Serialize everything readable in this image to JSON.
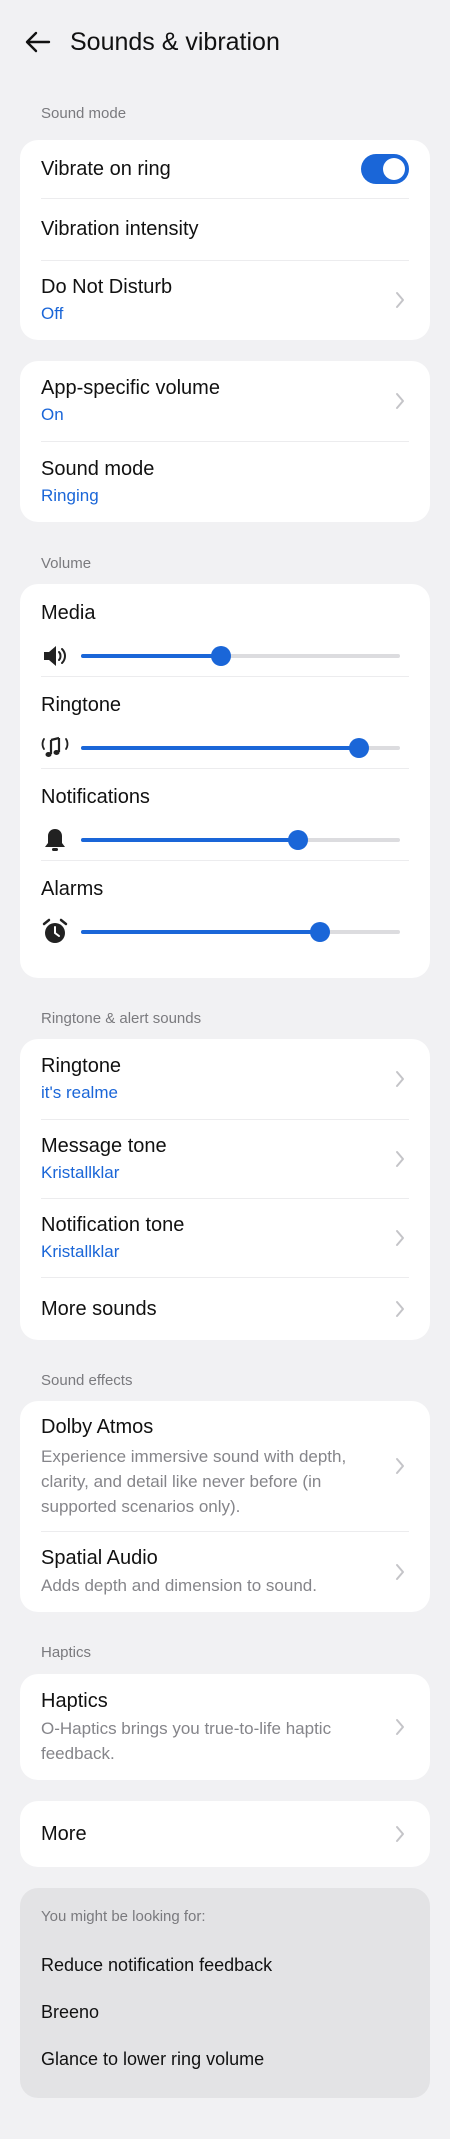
{
  "header": {
    "title": "Sounds & vibration"
  },
  "sections": {
    "sound_mode": "Sound mode",
    "volume": "Volume",
    "ringtone_alert": "Ringtone & alert sounds",
    "sound_effects": "Sound effects",
    "haptics": "Haptics"
  },
  "sound_mode_card": {
    "vibrate_on_ring": "Vibrate on ring",
    "vibrate_on_ring_enabled": true,
    "vibration_intensity": "Vibration intensity",
    "dnd_title": "Do Not Disturb",
    "dnd_value": "Off"
  },
  "app_card": {
    "app_volume_title": "App-specific volume",
    "app_volume_value": "On",
    "sound_mode_title": "Sound mode",
    "sound_mode_value": "Ringing"
  },
  "volume": {
    "media": {
      "label": "Media",
      "level": 0.44
    },
    "ringtone": {
      "label": "Ringtone",
      "level": 0.87
    },
    "notifications": {
      "label": "Notifications",
      "level": 0.68
    },
    "alarms": {
      "label": "Alarms",
      "level": 0.75
    }
  },
  "ringtone_card": {
    "ringtone_title": "Ringtone",
    "ringtone_value": "it's realme",
    "message_title": "Message tone",
    "message_value": "Kristallklar",
    "notification_title": "Notification tone",
    "notification_value": "Kristallklar",
    "more_sounds": "More sounds"
  },
  "effects_card": {
    "dolby_title": "Dolby Atmos",
    "dolby_desc": "Experience immersive sound with depth, clarity, and detail like never before (in supported scenarios only).",
    "spatial_title": "Spatial Audio",
    "spatial_desc": "Adds depth and dimension to sound."
  },
  "haptics_card": {
    "title": "Haptics",
    "desc": "O-Haptics brings you true-to-life haptic feedback."
  },
  "more": {
    "label": "More"
  },
  "suggestions": {
    "title": "You might be looking for:",
    "items": [
      "Reduce notification feedback",
      "Breeno",
      "Glance to lower ring volume"
    ]
  },
  "colors": {
    "accent": "#1a66d8",
    "background": "#f1f1f3",
    "card": "#ffffff"
  }
}
